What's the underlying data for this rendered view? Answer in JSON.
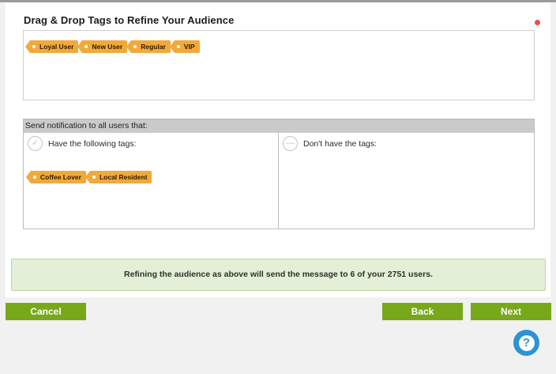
{
  "header": {
    "title": "Drag & Drop Tags to Refine Your Audience"
  },
  "tag_pool": {
    "tags": [
      "Loyal User",
      "New User",
      "Regular",
      "VIP"
    ]
  },
  "notify": {
    "header": "Send notification to all users that:",
    "have_tags": {
      "label": "Have the following tags:",
      "tags": [
        "Coffee Lover",
        "Local Resident"
      ]
    },
    "dont_have_tags": {
      "label": "Don't have the tags:",
      "tags": []
    }
  },
  "info": {
    "message": "Refining the audience as above will send the message to 6 of your 2751 users."
  },
  "buttons": {
    "cancel": "Cancel",
    "back": "Back",
    "next": "Next",
    "help": "?"
  },
  "colors": {
    "tag": "#f2a93b",
    "button": "#77a81a",
    "help": "#2b93d6",
    "info_bg": "#e3efd6",
    "status_dot": "#ee4b4b"
  }
}
